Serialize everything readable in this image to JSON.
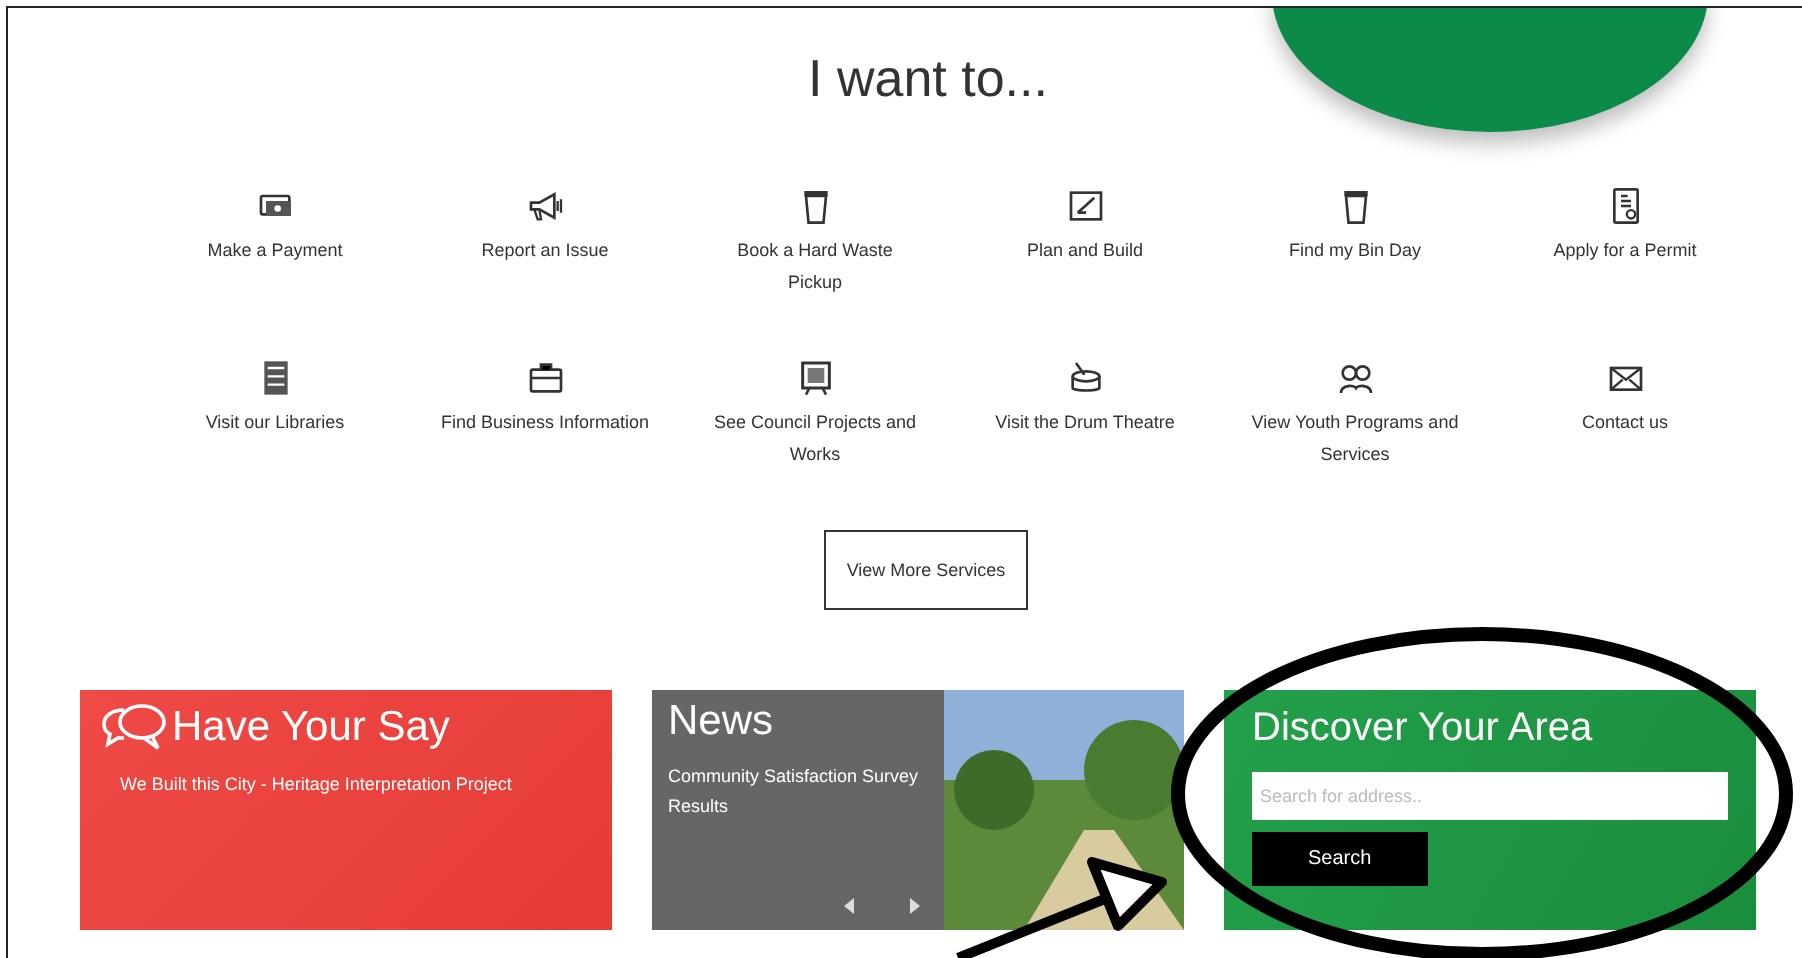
{
  "title": "I want to...",
  "services": [
    "Make a Payment",
    "Report an Issue",
    "Book a Hard Waste Pickup",
    "Plan and Build",
    "Find my Bin Day",
    "Apply for a Permit",
    "Visit our Libraries",
    "Find Business Information",
    "See Council Projects and Works",
    "Visit the Drum Theatre",
    "View Youth Programs and Services",
    "Contact us"
  ],
  "more_button": "View More Services",
  "have_your_say": {
    "title": "Have Your Say",
    "text": "We Built this City - Heritage Interpretation Project"
  },
  "news": {
    "title": "News",
    "text": "Community Satisfaction Survey Results"
  },
  "discover": {
    "title": "Discover Your Area",
    "placeholder": "Search for address..",
    "button": "Search"
  }
}
